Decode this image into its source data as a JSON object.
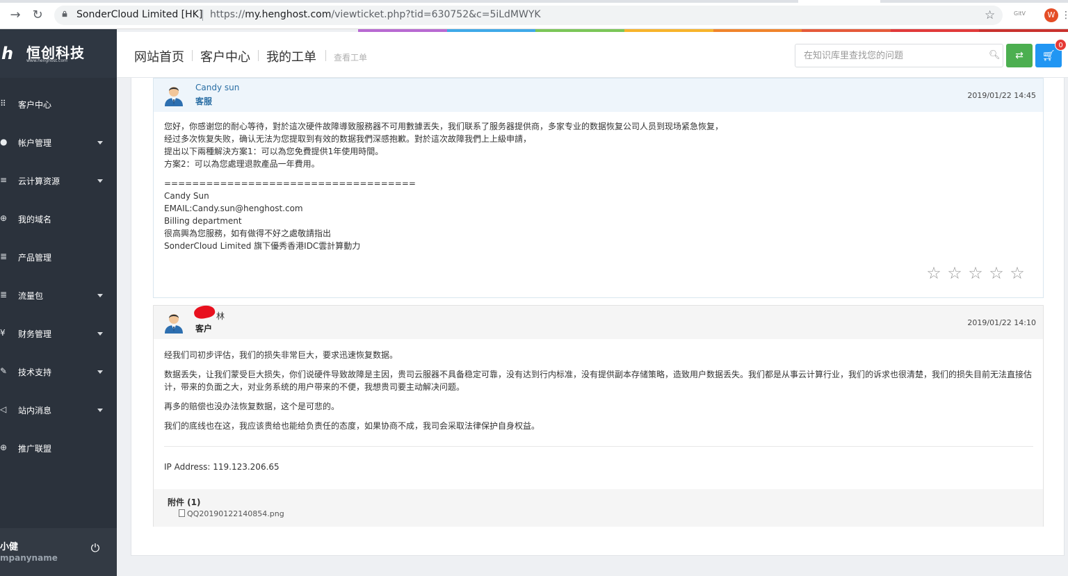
{
  "browser": {
    "site_name": "SonderCloud Limited [HK]",
    "url_prefix": "https://",
    "url_host": "my.henghost.com",
    "url_path": "/viewticket.php?tid=630752&c=5iLdMWYK",
    "extension_label": "GitV",
    "profile_initial": "W"
  },
  "brand": {
    "mark": "h",
    "name": "恒创科技",
    "sub": "www.henghost.com"
  },
  "sidebar": {
    "items": [
      {
        "label": "客户中心",
        "icon": "grid-icon",
        "caret": false
      },
      {
        "label": "帐户管理",
        "icon": "user-icon",
        "caret": true
      },
      {
        "label": "云计算资源",
        "icon": "cloud-icon",
        "caret": true
      },
      {
        "label": "我的域名",
        "icon": "globe-icon",
        "caret": false
      },
      {
        "label": "产品管理",
        "icon": "server-icon",
        "caret": false
      },
      {
        "label": "流量包",
        "icon": "database-icon",
        "caret": true
      },
      {
        "label": "财务管理",
        "icon": "money-icon",
        "caret": true
      },
      {
        "label": "技术支持",
        "icon": "wrench-icon",
        "caret": true
      },
      {
        "label": "站内消息",
        "icon": "message-icon",
        "caret": true
      },
      {
        "label": "推广联盟",
        "icon": "globe-icon",
        "caret": false
      }
    ],
    "user_name": "小健",
    "company_name": "mpanyname"
  },
  "header": {
    "crumbs": [
      "网站首页",
      "客户中心",
      "我的工单"
    ],
    "current": "查看工单",
    "search_placeholder": "在知识库里查找您的问题",
    "cart_count": "0"
  },
  "messages": [
    {
      "author": "Candy sun",
      "role": "客服",
      "date": "2019/01/22 14:45",
      "lines": [
        "您好，你感谢您的耐心等待，對於這次硬件故障導致服務器不可用數據丟失，我们联系了服务器提供商，多家专业的数据恢复公司人员到现场紧急恢复，",
        "经过多次恢复失败，确认无法为您提取到有效的数据我們深感抱歉。對於這次故障我們上上級申請，",
        "提出以下兩種解決方案1：可以為您免費提供1年使用時間。",
        "方案2：可以為您處理退款產品一年費用。"
      ],
      "signature": [
        "====================================",
        "Candy Sun",
        "EMAIL:Candy.sun@henghost.com",
        "Billing department",
        "很高興為您服務，如有做得不好之處敬請指出",
        "SonderCloud Limited 旗下優秀香港IDC雲計算動力"
      ],
      "rating_stars": [
        "☆",
        "☆",
        "☆",
        "☆",
        "☆"
      ]
    },
    {
      "author": "林",
      "role": "客户",
      "date": "2019/01/22 14:10",
      "paragraphs": [
        "经我们司初步评估，我们的损失非常巨大，要求迅速恢复数据。",
        "数据丢失，让我们蒙受巨大损失，你们说硬件导致故障是主因，贵司云服器不具备稳定可靠，没有达到行内标准，没有提供副本存储策略，造致用户数据丢失。我们都是从事云计算行业，我们的诉求也很清楚，我们的损失目前无法直接估计，带来的负面之大，对业务系统的用户带来的不便，我想贵司要主动解决问题。",
        "再多的赔偿也没办法恢复数据，这个是可悲的。",
        "我们的底线也在这，我应该贵给也能给负责任的态度，如果协商不成，我司会采取法律保护自身权益。"
      ],
      "ip": "IP Address: 119.123.206.65",
      "attachments_title": "附件 (1)",
      "attachment_file": "QQ20190122140854.png"
    }
  ],
  "colors": {
    "sidebar_bg": "#2b323c",
    "staff_header": "#eef5fb",
    "link_blue": "#2a6ea4",
    "lang_green": "#4caf50",
    "cart_blue": "#2196f3",
    "rainbow": [
      "#b86ad2",
      "#3fa9e8",
      "#7bc658",
      "#f7b42c",
      "#f0842c",
      "#e55a3a",
      "#e13a3a",
      "#c9322e"
    ]
  }
}
